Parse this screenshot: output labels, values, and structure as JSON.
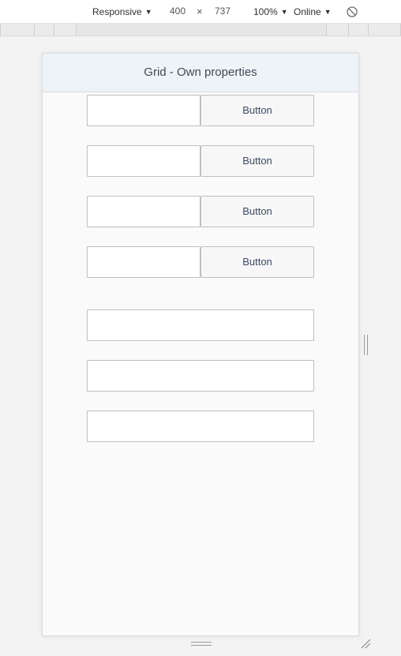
{
  "toolbar": {
    "device_label": "Responsive",
    "width_value": "400",
    "times_symbol": "×",
    "height_value": "737",
    "zoom_label": "100%",
    "throttle_label": "Online",
    "caret": "▼",
    "rotate_icon": "rotate-icon"
  },
  "page": {
    "title": "Grid - Own properties"
  },
  "input_button_rows": [
    {
      "input_value": "",
      "button_label": "Button"
    },
    {
      "input_value": "",
      "button_label": "Button"
    },
    {
      "input_value": "",
      "button_label": "Button"
    },
    {
      "input_value": "",
      "button_label": "Button"
    }
  ],
  "wide_inputs": [
    {
      "value": ""
    },
    {
      "value": ""
    },
    {
      "value": ""
    }
  ],
  "colors": {
    "header_bg": "#eef3f8",
    "button_text": "#3b4b63",
    "page_bg": "#fafafa"
  }
}
